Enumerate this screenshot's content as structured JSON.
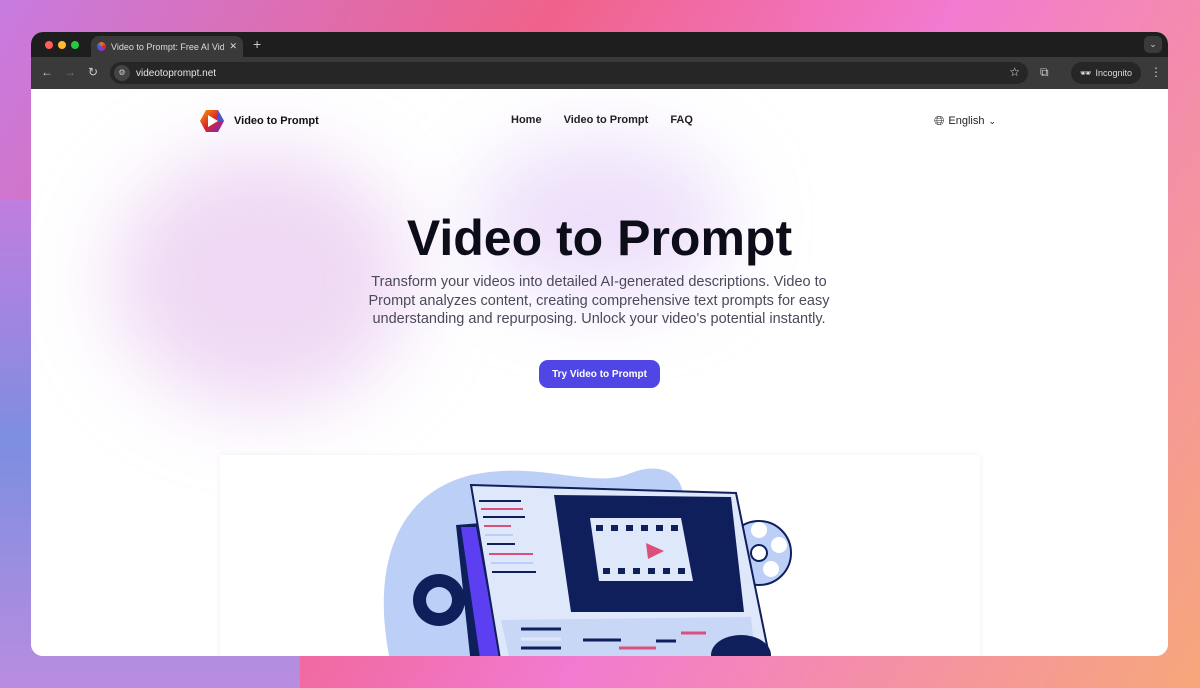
{
  "browser": {
    "tab_title": "Video to Prompt: Free AI Video",
    "url": "videotoprompt.net",
    "profile": "Incognito"
  },
  "nav": {
    "brand": "Video to Prompt",
    "links": [
      "Home",
      "Video to Prompt",
      "FAQ"
    ],
    "language": "English"
  },
  "hero": {
    "title": "Video to Prompt",
    "description": "Transform your videos into detailed AI-generated descriptions. Video to Prompt analyzes content, creating comprehensive text prompts for easy understanding and repurposing. Unlock your video's potential instantly.",
    "cta": "Try Video to Prompt"
  },
  "colors": {
    "accent": "#4f46e5",
    "navy": "#0f1f5c",
    "pink": "#d9507a",
    "light_blue": "#bcd0f7"
  }
}
